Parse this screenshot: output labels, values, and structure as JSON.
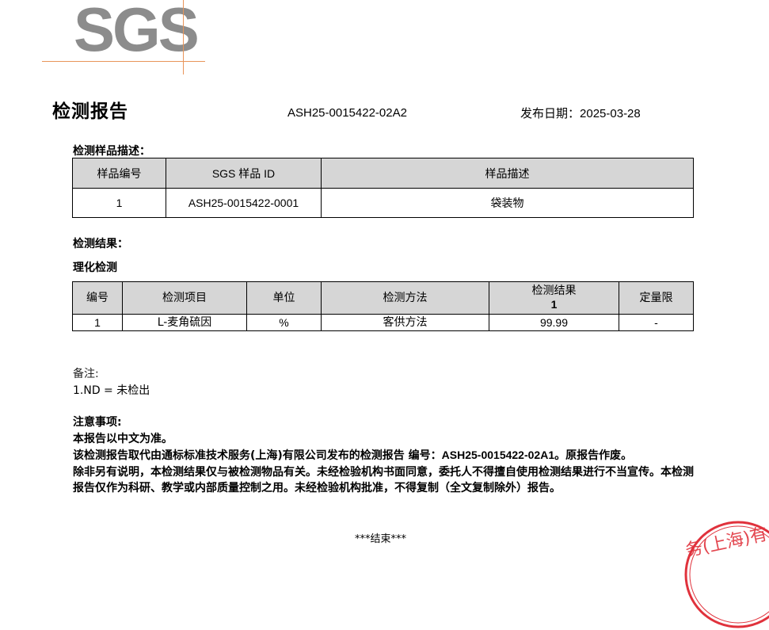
{
  "logo": {
    "text": "SGS"
  },
  "header": {
    "title": "检测报告",
    "report_number": "ASH25-0015422-02A2",
    "publish_label": "发布日期：",
    "publish_date": "2025-03-28"
  },
  "sample_section": {
    "label": "检测样品描述：",
    "columns": [
      "样品编号",
      "SGS 样品 ID",
      "样品描述"
    ],
    "rows": [
      [
        "1",
        "ASH25-0015422-0001",
        "袋装物"
      ]
    ]
  },
  "results_section": {
    "label": "检测结果：",
    "sub_label": "理化检测",
    "columns": [
      "编号",
      "检测项目",
      "单位",
      "检测方法",
      "检测结果",
      "定量限"
    ],
    "result_sub_header": "1",
    "rows": [
      [
        "1",
        "L-麦角硫因",
        "%",
        "客供方法",
        "99.99",
        "-"
      ]
    ]
  },
  "notes": {
    "heading": "备注:",
    "items": [
      "1.ND = 未检出"
    ]
  },
  "attention": {
    "heading": "注意事项:",
    "line1": "本报告以中文为准。",
    "line2_prefix": "该检测报告取代由通标标准技术服务(上海)有限公司发布的检测报告 编号：",
    "line2_number": "ASH25-0015422-02A1",
    "line2_suffix": "。原报告作废。",
    "line3": "除非另有说明，本检测结果仅与被检测物品有关。未经检验机构书面同意，委托人不得擅自使用检测结果进行不当宣传。本检测报告仅作为科研、教学或内部质量控制之用。未经检验机构批准，不得复制（全文复制除外）报告。"
  },
  "end_marker": "***结束***",
  "stamp": {
    "text": "务(上海)有",
    "color": "#e0323c"
  },
  "colors": {
    "logo_gray": "#8c8c8c",
    "logo_line": "#e8955a",
    "header_fill": "#d6d6d6"
  }
}
